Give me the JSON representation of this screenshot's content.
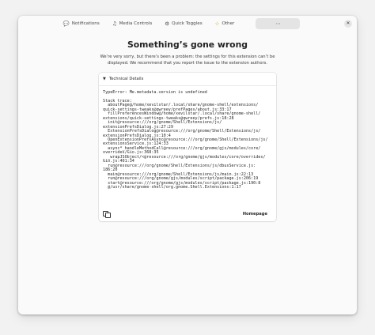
{
  "header": {
    "tabs": [
      {
        "label": "Notifications",
        "icon": "💬",
        "icon_name": "notifications-icon"
      },
      {
        "label": "Media Controls",
        "icon": "♫",
        "icon_name": "media-controls-icon"
      },
      {
        "label": "Quick Toggles",
        "icon": "⚙",
        "icon_name": "quick-toggles-icon"
      },
      {
        "label": "Other",
        "icon": "☆",
        "icon_name": "other-star-icon"
      },
      {
        "label": "",
        "icon": "⋯",
        "icon_name": "more-icon"
      }
    ],
    "close": "✕"
  },
  "error": {
    "title": "Something’s gone wrong",
    "description": "We’re very sorry, but there’s been a problem: the settings for this extension can’t be displayed. We recommend that you report the issue to the extension authors."
  },
  "details": {
    "label": "Technical Details",
    "expander_icon": "▼",
    "log": "TypeError: Me.metadata.version is undefined\n\nStack trace:\n  aboutPage@/home/xevilstar/.local/share/gnome-shell/extensions/\nquick-settings-tweaks@qwreey/prefPages/about.js:33:17\n  fillPreferencesWindow@/home/xevilstar/.local/share/gnome-shell/\nextensions/quick-settings-tweaks@qwreey/prefs.js:18:28\n  init@resource:///org/gnome/Shell/Extensions/js/\nextensionPrefsDialog.js:27:29\n  ExtensionPrefsDialog@resource:///org/gnome/Shell/Extensions/js/\nextensionPrefsDialog.js:10:4\n  OpenExtensionPrefsAsync@resource:///org/gnome/Shell/Extensions/js/\nextensionsService.js:124:33\n  async*_handleMethodCall@resource:///org/gnome/gjs/modules/core/\noverrides/Gio.js:368:35\n  _wrapJSObject/<@resource:///org/gnome/gjs/modules/core/overrides/\nGio.js:401:34\n  run@resource:///org/gnome/Shell/Extensions/js/dbusService.js:\n186:20\n  main@resource:///org/gnome/Shell/Extensions/js/main.js:22:13\n  run@resource:///org/gnome/gjs/modules/script/package.js:206:19\n  start@resource:///org/gnome/gjs/modules/script/package.js:190:8\n  @/usr/share/gnome-shell/org.gnome.Shell.Extensions:1:17",
    "homepage_label": "Homepage",
    "copy_icon": "copy-icon"
  }
}
